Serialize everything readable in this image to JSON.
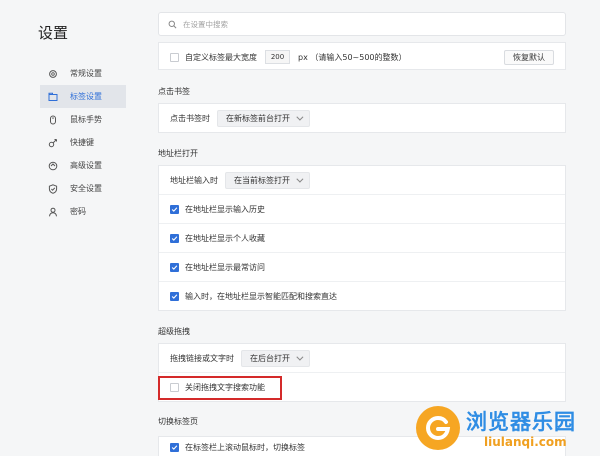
{
  "app_title": "设置",
  "search": {
    "placeholder": "在设置中搜索"
  },
  "sidebar": {
    "items": [
      {
        "label": "常规设置",
        "icon": "gear-icon"
      },
      {
        "label": "标签设置",
        "icon": "tab-icon"
      },
      {
        "label": "鼠标手势",
        "icon": "mouse-icon"
      },
      {
        "label": "快捷键",
        "icon": "shortcut-icon"
      },
      {
        "label": "高级设置",
        "icon": "advanced-icon"
      },
      {
        "label": "安全设置",
        "icon": "shield-icon"
      },
      {
        "label": "密码",
        "icon": "user-icon"
      }
    ],
    "active_index": 1
  },
  "tab_width": {
    "label": "自定义标签最大宽度",
    "value": "200",
    "hint": "px （请输入50~500的整数）",
    "restore_label": "恢复默认",
    "checked": false
  },
  "bookmark_section": {
    "title": "点击书签",
    "row_label": "点击书签时",
    "dropdown_value": "在新标签前台打开"
  },
  "addressbar_section": {
    "title": "地址栏打开",
    "row_label": "地址栏输入时",
    "dropdown_value": "在当前标签打开",
    "options": [
      {
        "label": "在地址栏显示输入历史",
        "checked": true
      },
      {
        "label": "在地址栏显示个人收藏",
        "checked": true
      },
      {
        "label": "在地址栏显示最常访问",
        "checked": true
      },
      {
        "label": "输入时，在地址栏显示智能匹配和搜索直达",
        "checked": true
      }
    ]
  },
  "drag_section": {
    "title": "超级拖拽",
    "row_label": "拖拽链接或文字时",
    "dropdown_value": "在后台打开",
    "option": {
      "label": "关闭拖拽文字搜索功能",
      "checked": false
    }
  },
  "switch_section": {
    "title": "切换标签页",
    "option": {
      "label": "在标签栏上滚动鼠标时，切换标签",
      "checked": true
    }
  },
  "watermark": {
    "title": "浏览器乐园",
    "subtitle": "liulanqi.com"
  },
  "colors": {
    "accent": "#2f6fd8",
    "highlight": "#d42a2a",
    "watermark_blue": "#2f8de4",
    "watermark_orange": "#f6a623"
  }
}
